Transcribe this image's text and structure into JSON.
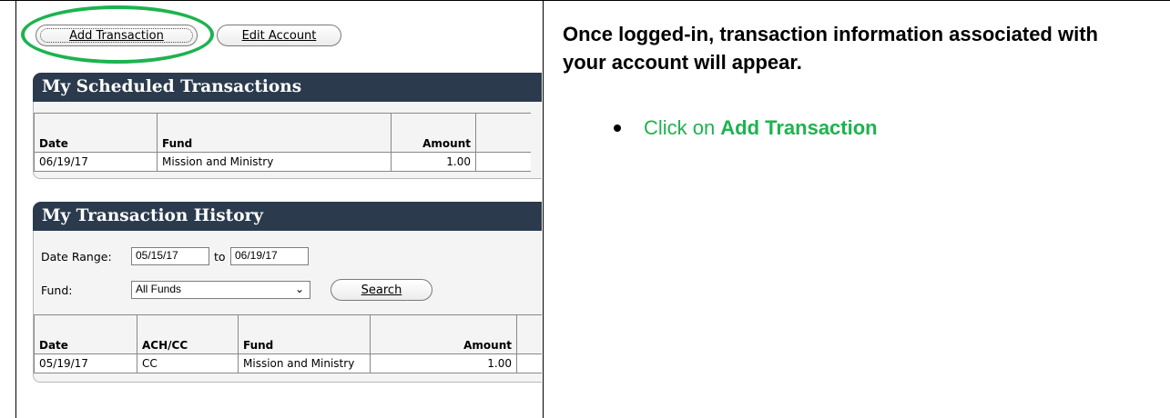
{
  "left": {
    "buttons": {
      "add": "Add Transaction",
      "edit": "Edit Account"
    },
    "scheduled": {
      "title": "My Scheduled Transactions",
      "headers": [
        "Date",
        "Fund",
        "Amount"
      ],
      "rows": [
        [
          "06/19/17",
          "Mission and Ministry",
          "1.00"
        ]
      ]
    },
    "history": {
      "title": "My Transaction History",
      "date_range_label": "Date Range:",
      "date_from": "05/15/17",
      "to_label": "to",
      "date_to": "06/19/17",
      "fund_label": "Fund:",
      "fund_selected": "All Funds",
      "search_label": "Search",
      "headers": [
        "Date",
        "ACH/CC",
        "Fund",
        "Amount"
      ],
      "rows": [
        [
          "05/19/17",
          "CC",
          "Mission and Ministry",
          "1.00"
        ]
      ]
    },
    "highlight_color": "#1db34f"
  },
  "right": {
    "intro": "Once logged-in, transaction information associated with your account will appear.",
    "bullet_prefix": "Click on",
    "bullet_bold": "Add Transaction",
    "bullet_color": "#1db34f"
  }
}
